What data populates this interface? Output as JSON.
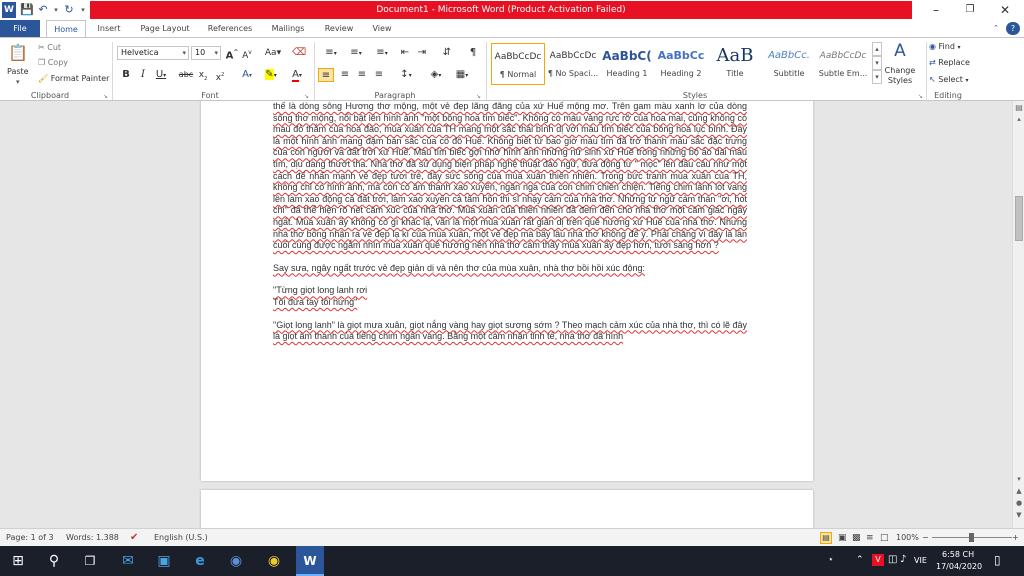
{
  "app": {
    "title": "Document1 - Microsoft Word (Product Activation Failed)",
    "help_icon": "?"
  },
  "tabs": [
    "File",
    "Home",
    "Insert",
    "Page Layout",
    "References",
    "Mailings",
    "Review",
    "View"
  ],
  "clipboard": {
    "paste": "Paste",
    "cut": "Cut",
    "copy": "Copy",
    "format_painter": "Format Painter",
    "label": "Clipboard"
  },
  "font": {
    "name": "Helvetica",
    "size": "10",
    "label": "Font"
  },
  "paragraph": {
    "label": "Paragraph"
  },
  "styles": {
    "label": "Styles",
    "items": [
      {
        "sample": "AaBbCcDc",
        "name": "¶ Normal"
      },
      {
        "sample": "AaBbCcDc",
        "name": "¶ No Spaci..."
      },
      {
        "sample": "AaBbC(",
        "name": "Heading 1"
      },
      {
        "sample": "AaBbCc",
        "name": "Heading 2"
      },
      {
        "sample": "AaB",
        "name": "Title"
      },
      {
        "sample": "AaBbCc.",
        "name": "Subtitle"
      },
      {
        "sample": "AaBbCcDc",
        "name": "Subtle Em..."
      }
    ],
    "change_styles": "Change Styles"
  },
  "editing": {
    "find": "Find",
    "replace": "Replace",
    "select": "Select",
    "label": "Editing"
  },
  "document": {
    "paragraphs": [
      "thế là dòng sông Hương thơ mộng, một vẻ đẹp lãng đãng của xứ Huế mộng mơ. Trên gam màu xanh lơ của dòng sông thơ mộng, nổi bật lên hình ảnh \"một bông hoa tím biếc\". Không có màu vàng rực rỡ của hoa mai, cũng không có màu đỏ thắm của hoa đào, mùa xuân của TH mang một sắc thái bình dị với màu tím biếc của bông hoa lục bình. Đây là một hình ảnh mang đậm bản sắc của cố đô Huế. Không biết từ bao giờ màu tím đã trở thành màu sắc đặc trưng của con người và đất trời xứ Huế. Màu tím biếc gợi nhớ hình ảnh những nữ sinh xứ Huế trong những bộ áo dài màu tím, dịu dàng thướt tha. Nhà thơ đã sử dụng biện pháp nghệ thuật đảo ngữ, đưa động từ \" mọc\" lên đầu câu như một cách để nhấn mạnh vẻ đẹp tươi trẻ, đầy sức sống của mùa xuân thiên nhiên. Trong bức tranh mùa xuân của TH, không chỉ có hình ảnh, mà còn có âm thanh xao xuyến, ngân nga của con chim chiền chiện. Tiếng chim lảnh lót vang lên làm xao động cả đất trời, làm xao xuyến cả tâm hồn thi sĩ nhạy cảm của nhà thơ. Những từ ngữ cảm thán \"ơi, hót chi\" đã thể hiện rõ nét cảm xúc của nhà thơ. Mùa xuân của thiên nhiên đã đem đến cho nhà thơ một cảm giác ngây ngất. Mùa xuân ấy không có gì khác lạ, vẫn là một mùa xuân rất giản dị trên quê hương xứ Huế của nhà thơ. Nhưng nhà thơ bỗng nhận ra vẻ đẹp lạ kì của mùa xuân, một vẻ đẹp mà bấy lâu nhà thơ không để ý. Phải chăng vì đây là lần cuối cùng được ngắm nhìn mùa xuân quê hương nên nhà thơ cảm thấy mùa xuân ấy đẹp hơn, tươi sáng hơn ?",
      "Say sưa, ngây ngất trước vẻ đẹp giản dị và nên thơ của mùa xuân, nhà thơ bồi hồi xúc động:",
      "\"Từng giọt long lanh rơi",
      "Tôi đưa tay tôi hứng\"",
      "\"Giọt long lanh\" là giọt mưa xuân, giọt nắng vàng hay giọt sương sớm ? Theo mạch cảm xúc của nhà thơ, thì có lẽ đây là giọt âm thanh của tiếng chim ngân vang. Bằng một cảm nhận tinh tế, nhà thơ đã hình"
    ]
  },
  "status": {
    "page": "Page: 1 of 3",
    "words": "Words: 1.388",
    "language": "English (U.S.)",
    "zoom": "100%"
  },
  "taskbar": {
    "lang": "VIE",
    "time": "6:58 CH",
    "date": "17/04/2020"
  }
}
